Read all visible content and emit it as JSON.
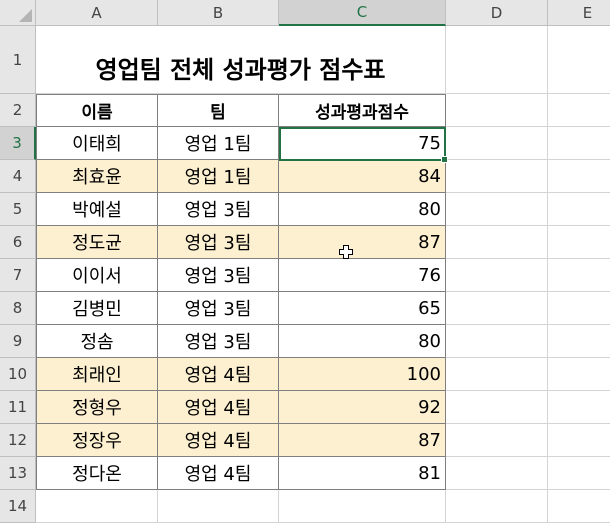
{
  "columns": [
    "A",
    "B",
    "C",
    "D",
    "E"
  ],
  "rows": [
    "1",
    "2",
    "3",
    "4",
    "5",
    "6",
    "7",
    "8",
    "9",
    "10",
    "11",
    "12",
    "13",
    "14"
  ],
  "title": "영업팀 전체 성과평가 점수표",
  "headers": {
    "name": "이름",
    "team": "팀",
    "score": "성과평과점수"
  },
  "records": [
    {
      "name": "이태희",
      "team": "영업 1팀",
      "score": "75",
      "highlight": false
    },
    {
      "name": "최효윤",
      "team": "영업 1팀",
      "score": "84",
      "highlight": true
    },
    {
      "name": "박예설",
      "team": "영업 3팀",
      "score": "80",
      "highlight": false
    },
    {
      "name": "정도균",
      "team": "영업 3팀",
      "score": "87",
      "highlight": true
    },
    {
      "name": "이이서",
      "team": "영업 3팀",
      "score": "76",
      "highlight": false
    },
    {
      "name": "김병민",
      "team": "영업 3팀",
      "score": "65",
      "highlight": false
    },
    {
      "name": "정솜",
      "team": "영업 3팀",
      "score": "80",
      "highlight": false
    },
    {
      "name": "최래인",
      "team": "영업 4팀",
      "score": "100",
      "highlight": true
    },
    {
      "name": "정형우",
      "team": "영업 4팀",
      "score": "92",
      "highlight": true
    },
    {
      "name": "정장우",
      "team": "영업 4팀",
      "score": "87",
      "highlight": true
    },
    {
      "name": "정다온",
      "team": "영업 4팀",
      "score": "81",
      "highlight": false
    }
  ],
  "colors": {
    "highlight": "#fdf0d0",
    "accent": "#217346"
  },
  "icons": {
    "cursor": "plus-cursor-icon"
  }
}
